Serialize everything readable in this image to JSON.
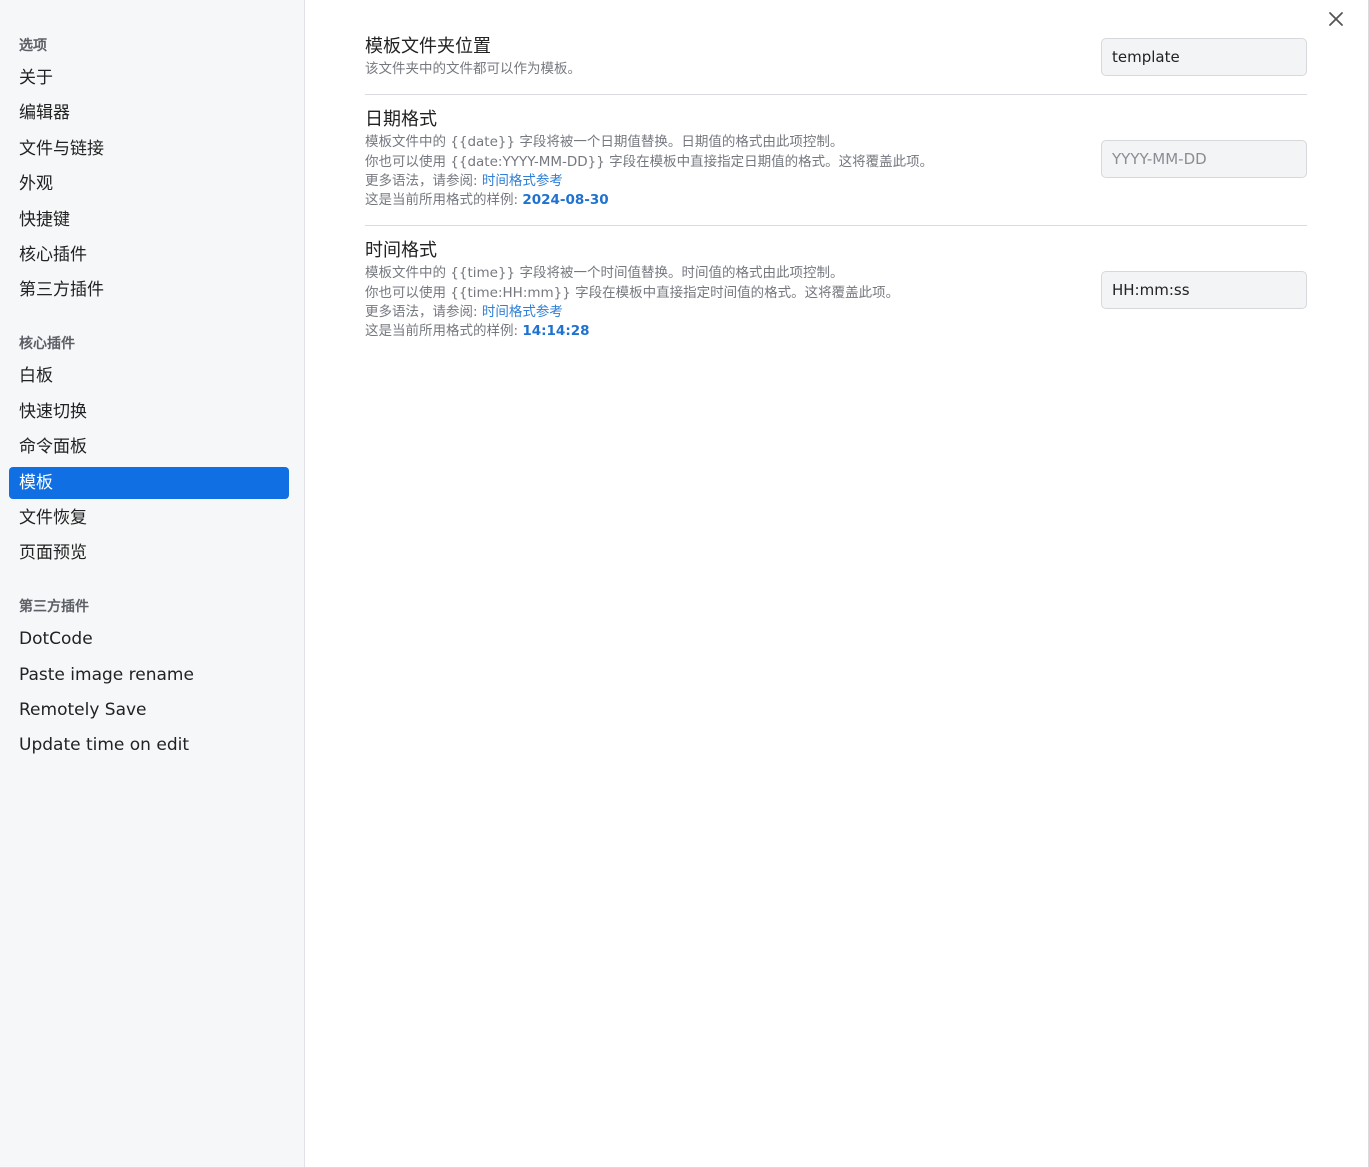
{
  "sidebar": {
    "sections": [
      {
        "heading": "选项",
        "items": [
          "关于",
          "编辑器",
          "文件与链接",
          "外观",
          "快捷键",
          "核心插件",
          "第三方插件"
        ]
      },
      {
        "heading": "核心插件",
        "items": [
          "白板",
          "快速切换",
          "命令面板",
          "模板",
          "文件恢复",
          "页面预览"
        ]
      },
      {
        "heading": "第三方插件",
        "items": [
          "DotCode",
          "Paste image rename",
          "Remotely Save",
          "Update time on edit"
        ]
      }
    ],
    "active_item": "模板"
  },
  "settings": {
    "folder": {
      "title": "模板文件夹位置",
      "desc": "该文件夹中的文件都可以作为模板。",
      "value": "template",
      "placeholder": ""
    },
    "date": {
      "title": "日期格式",
      "line1": "模板文件中的 {{date}} 字段将被一个日期值替换。日期值的格式由此项控制。",
      "line2": "你也可以使用 {{date:YYYY-MM-DD}} 字段在模板中直接指定日期值的格式。这将覆盖此项。",
      "line3_prefix": "更多语法，请参阅: ",
      "line3_link": "时间格式参考",
      "line4_prefix": "这是当前所用格式的样例: ",
      "line4_sample": "2024-08-30",
      "value": "",
      "placeholder": "YYYY-MM-DD"
    },
    "time": {
      "title": "时间格式",
      "line1": "模板文件中的 {{time}} 字段将被一个时间值替换。时间值的格式由此项控制。",
      "line2": "你也可以使用 {{time:HH:mm}} 字段在模板中直接指定时间值的格式。这将覆盖此项。",
      "line3_prefix": "更多语法，请参阅: ",
      "line3_link": "时间格式参考",
      "line4_prefix": "这是当前所用格式的样例: ",
      "line4_sample": "14:14:28",
      "value": "HH:mm:ss",
      "placeholder": ""
    }
  },
  "icons": {
    "close": "close-icon"
  },
  "colors": {
    "accent": "#0f6fe3",
    "link": "#2f7fd7",
    "sidebar_bg": "#f6f7f8"
  }
}
